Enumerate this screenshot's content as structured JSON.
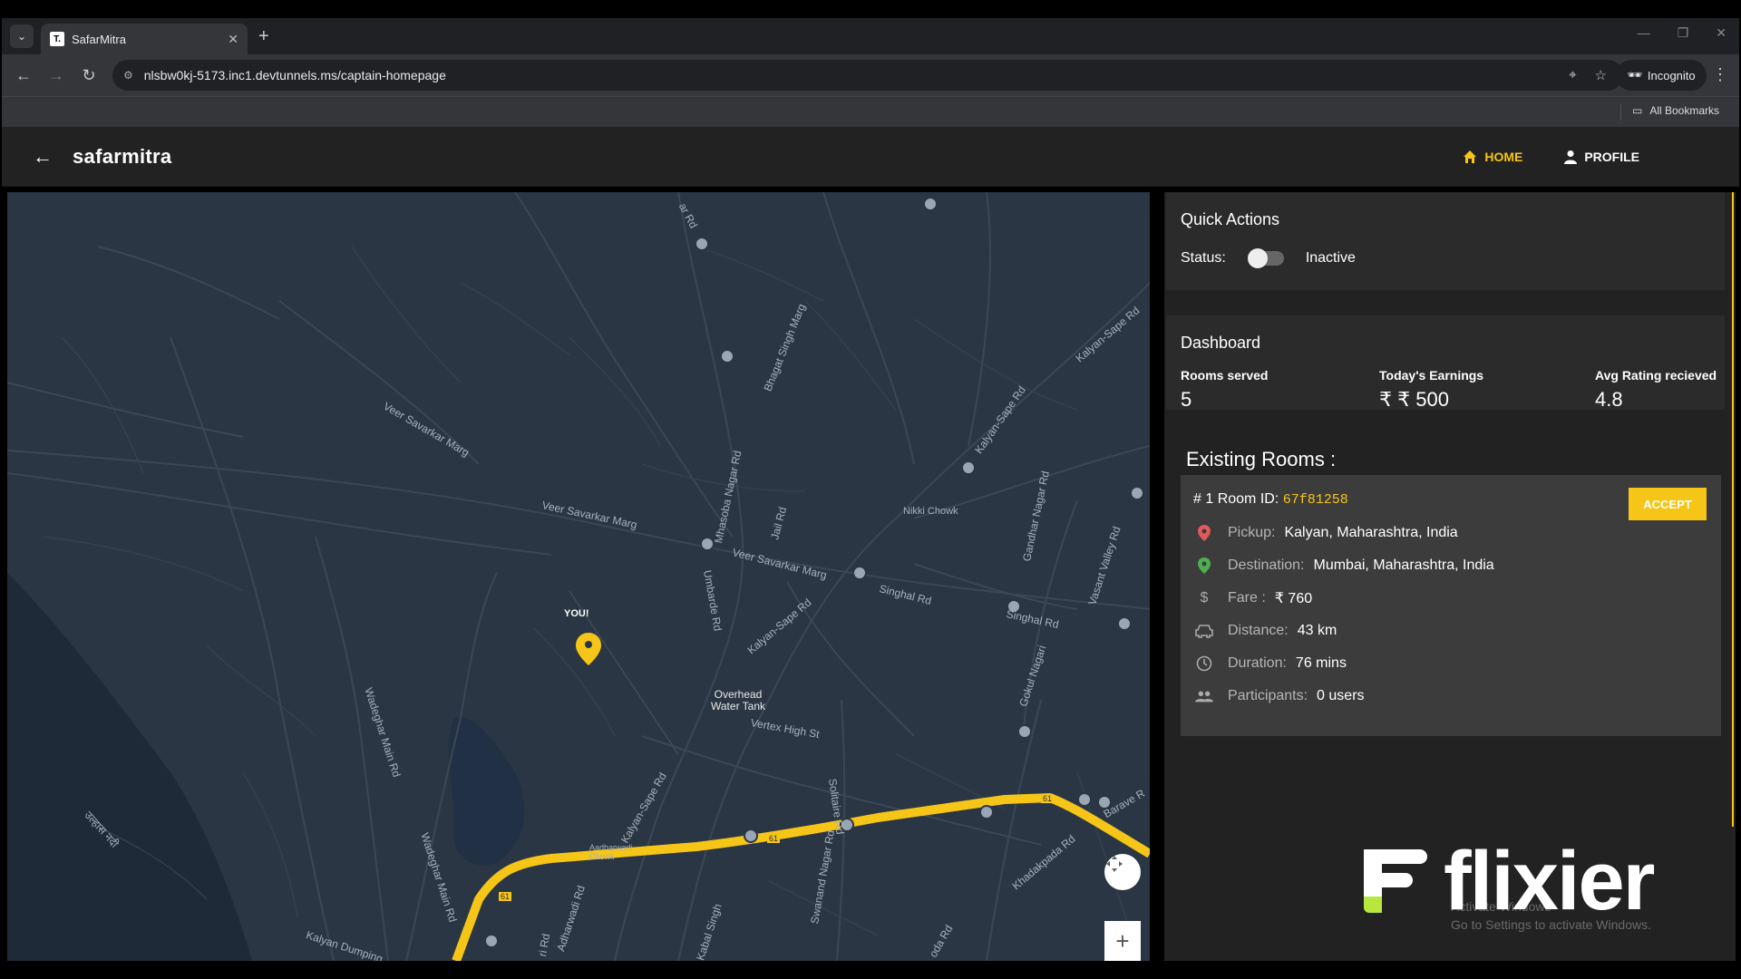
{
  "browser": {
    "tab_title": "SafarMitra",
    "favicon_text": "T.",
    "url": "nlsbw0kj-5173.inc1.devtunnels.ms/captain-homepage",
    "incognito_label": "Incognito",
    "bookmarks_label": "All Bookmarks"
  },
  "app": {
    "back_icon": "arrow-left-icon",
    "brand": "safarmitra",
    "nav": {
      "home": "HOME",
      "profile": "PROFILE"
    },
    "accent_color": "#f5c518"
  },
  "map": {
    "you_label": "YOU!",
    "labels": {
      "veer_savarkar_marg_1": "Veer Savarkar Marg",
      "veer_savarkar_marg_2": "Veer Savarkar Marg",
      "veer_savarkar_marg_3": "Veer Savarkar Marg",
      "bhagat_singh_marg": "Bhagat Singh Marg",
      "mhasoba_nagar_rd": "Mhasoba Nagar Rd",
      "jail_rd": "Jail Rd",
      "kalyan_sape_rd_1": "Kalyan-Sape Rd",
      "kalyan_sape_rd_2": "Kalyan-Sape Rd",
      "kalyan_sape_rd_3": "Kalyan-Sape Rd",
      "kalyan_sape_rd_4": "Kalyan-Sape Rd",
      "singhal_rd_1": "Singhal Rd",
      "singhal_rd_2": "Singhal Rd",
      "nikki_chowk": "Nikki Chowk",
      "gandhar_nagar_rd": "Gandhar Nagar Rd",
      "vasant_valley_rd": "Vasant Valley Rd",
      "umbarde_rd": "Umbarde Rd",
      "overhead_water_tank": "Overhead\nWater Tank",
      "vertex_high_st": "Vertex High St",
      "wadeghar_main_rd_1": "Wadeghar Main Rd",
      "wadeghar_main_rd_2": "Wadeghar Main Rd",
      "solitaire_rd": "Solitaire Rd",
      "gokul_nagari": "Gokul Nagari",
      "barave_rd": "Barave R",
      "khadakpada_rd": "Khadakpada Rd",
      "swanand_nagar_rd": "Swanand Nagar Rd",
      "adharwadi_rd": "Adharwadi Rd",
      "aadharwadi_chowk": "Aadharwadi\nChowk",
      "kalyan_dumping": "Kalyan Dumping",
      "river_name": "उल्हास नदी",
      "highway_num_1": "61",
      "highway_num_2": "61",
      "highway_num_3": "61",
      "rd_top": "ar Rd",
      "kabal_singh": "Kabal Singh",
      "yoda_rd": "oda Rd",
      "road_left_bottom": "ri Rd"
    }
  },
  "quick_actions": {
    "title": "Quick Actions",
    "status_label": "Status:",
    "status_value": "Inactive",
    "toggle_on": false
  },
  "dashboard": {
    "title": "Dashboard",
    "stats": [
      {
        "label": "Rooms served",
        "value": "5"
      },
      {
        "label": "Today's Earnings",
        "value": "₹ ₹ 500"
      },
      {
        "label": "Avg Rating recieved",
        "value": "4.8"
      }
    ]
  },
  "rooms": {
    "title": "Existing Rooms :",
    "items": [
      {
        "prefix": "# 1 Room ID:",
        "id": "67f81258",
        "accept_label": "ACCEPT",
        "pickup_label": "Pickup:",
        "pickup": "Kalyan, Maharashtra, India",
        "destination_label": "Destination:",
        "destination": "Mumbai, Maharashtra, India",
        "fare_label": "Fare :",
        "fare": "₹ 760",
        "distance_label": "Distance:",
        "distance": "43 km",
        "duration_label": "Duration:",
        "duration": "76 mins",
        "participants_label": "Participants:",
        "participants": "0 users"
      }
    ]
  },
  "watermark": {
    "brand": "flixier",
    "activate_windows": "Activate Windows\nGo to Settings to activate Windows."
  }
}
